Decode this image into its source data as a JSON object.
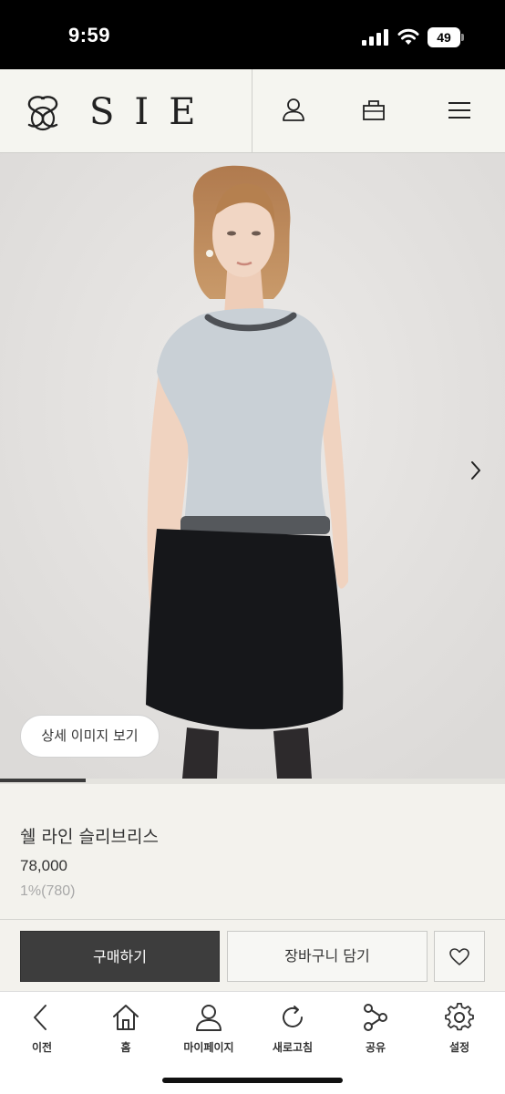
{
  "status_bar": {
    "time": "9:59",
    "battery": "49"
  },
  "header": {
    "brand": "SIE"
  },
  "gallery": {
    "detail_button": "상세 이미지 보기",
    "progress": 0.17
  },
  "product": {
    "name": "쉘 라인 슬리브리스",
    "price": "78,000",
    "point": "1%(780)"
  },
  "actions": {
    "buy": "구매하기",
    "cart": "장바구니 담기"
  },
  "nav": [
    {
      "label": "이전",
      "icon": "back-icon"
    },
    {
      "label": "홈",
      "icon": "home-icon"
    },
    {
      "label": "마이페이지",
      "icon": "person-icon"
    },
    {
      "label": "새로고침",
      "icon": "refresh-icon"
    },
    {
      "label": "공유",
      "icon": "share-icon"
    },
    {
      "label": "설정",
      "icon": "gear-icon"
    }
  ]
}
